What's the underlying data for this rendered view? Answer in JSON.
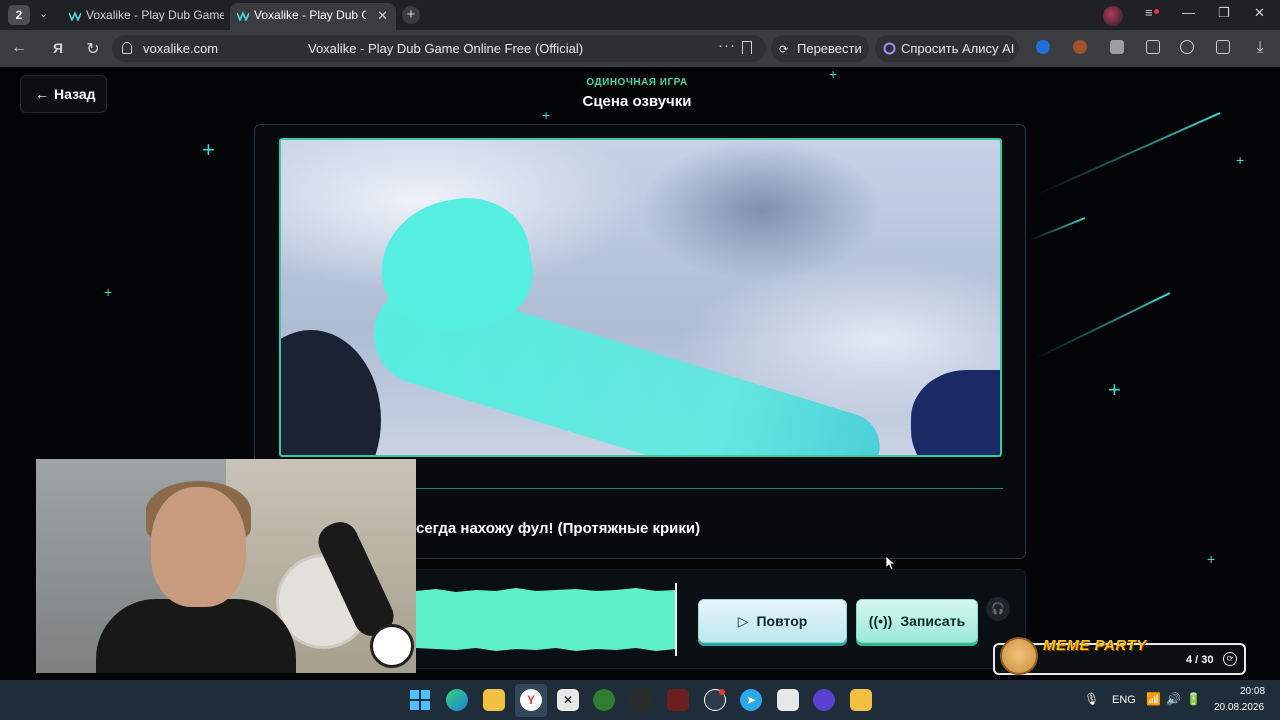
{
  "browser": {
    "tab_count": "2",
    "tabs": [
      {
        "label": "Voxalike - Play Dub Game Online Free (Official)"
      },
      {
        "label": "Voxalike - Play Dub Game Online Free (Official)"
      }
    ],
    "new_tab": "+",
    "address": {
      "domain": "voxalike.com",
      "page_title": "Voxalike - Play Dub Game Online Free (Official)",
      "more": "···"
    },
    "translate_label": "Перевести",
    "alice_label": "Спросить Алису AI"
  },
  "page": {
    "back_label": "Назад",
    "mode_label": "ОДИНОЧНАЯ ИГРА",
    "scene_title": "Сцена озвучки",
    "caption": "сегда нахожу фул! (Протяжные крики)",
    "replay_label": "Повтор",
    "record_label": "Записать"
  },
  "meme_widget": {
    "title": "MEME PARTY",
    "progress": "4 / 30"
  },
  "taskbar": {
    "lang": "ENG",
    "time": "20:08",
    "date": "20.08.2026"
  },
  "colors": {
    "accent": "#3fd6d6",
    "mode_label": "#43d9a8",
    "video_border": "#37c9a0"
  }
}
